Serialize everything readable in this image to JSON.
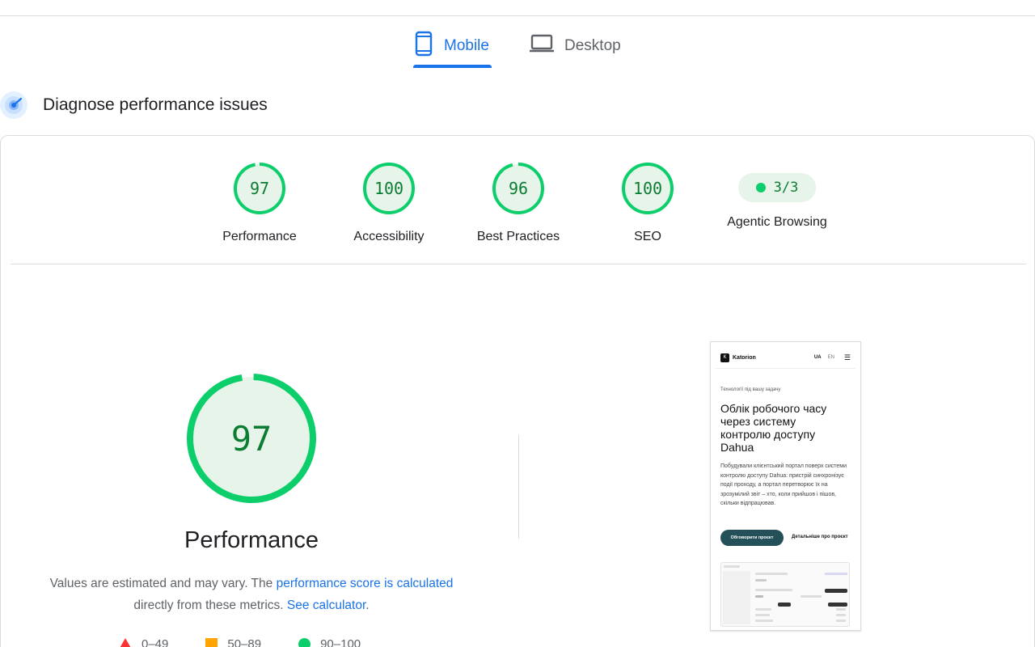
{
  "tabs": {
    "mobile_label": "Mobile",
    "desktop_label": "Desktop"
  },
  "section": {
    "title": "Diagnose performance issues"
  },
  "scores": [
    {
      "value": "97",
      "label": "Performance"
    },
    {
      "value": "100",
      "label": "Accessibility"
    },
    {
      "value": "96",
      "label": "Best Practices"
    },
    {
      "value": "100",
      "label": "SEO"
    }
  ],
  "agentic": {
    "value": "3/3",
    "label": "Agentic Browsing"
  },
  "performance": {
    "score": "97",
    "title": "Performance",
    "desc_text_1": "Values are estimated and may vary. The ",
    "desc_link_1": "performance score is calculated",
    "desc_text_2": " directly from these metrics. ",
    "desc_link_2": "See calculator",
    "desc_text_3": "."
  },
  "legend": {
    "poor": "0–49",
    "average": "50–89",
    "good": "90–100"
  },
  "colors": {
    "accent": "#1a73e8",
    "good": "#0cce6b",
    "good_text": "#0b7d32",
    "good_fill": "#e6f4ea",
    "average": "#ffa400",
    "poor": "#ff3333"
  },
  "thumbnail": {
    "brand": "Katorion",
    "lang_ua": "UA",
    "lang_en": "EN",
    "kicker": "Технології під вашу задачу",
    "heading": "Облік робочого часу через систему контролю доступу Dahua",
    "body": "Побудували клієнтський портал поверх системи контролю доступу Dahua: пристрій синхронізує події проходу, а портал перетворює їх на зрозумілий звіт – хто, коли прийшов і пішов, скільки відпрацював.",
    "primary_button": "Обговорити проєкт",
    "secondary_link": "Детальніше про проєкт"
  },
  "icons": {
    "mobile": "smartphone-icon",
    "desktop": "laptop-icon",
    "diagnose": "radar-icon",
    "menu": "hamburger-icon"
  }
}
